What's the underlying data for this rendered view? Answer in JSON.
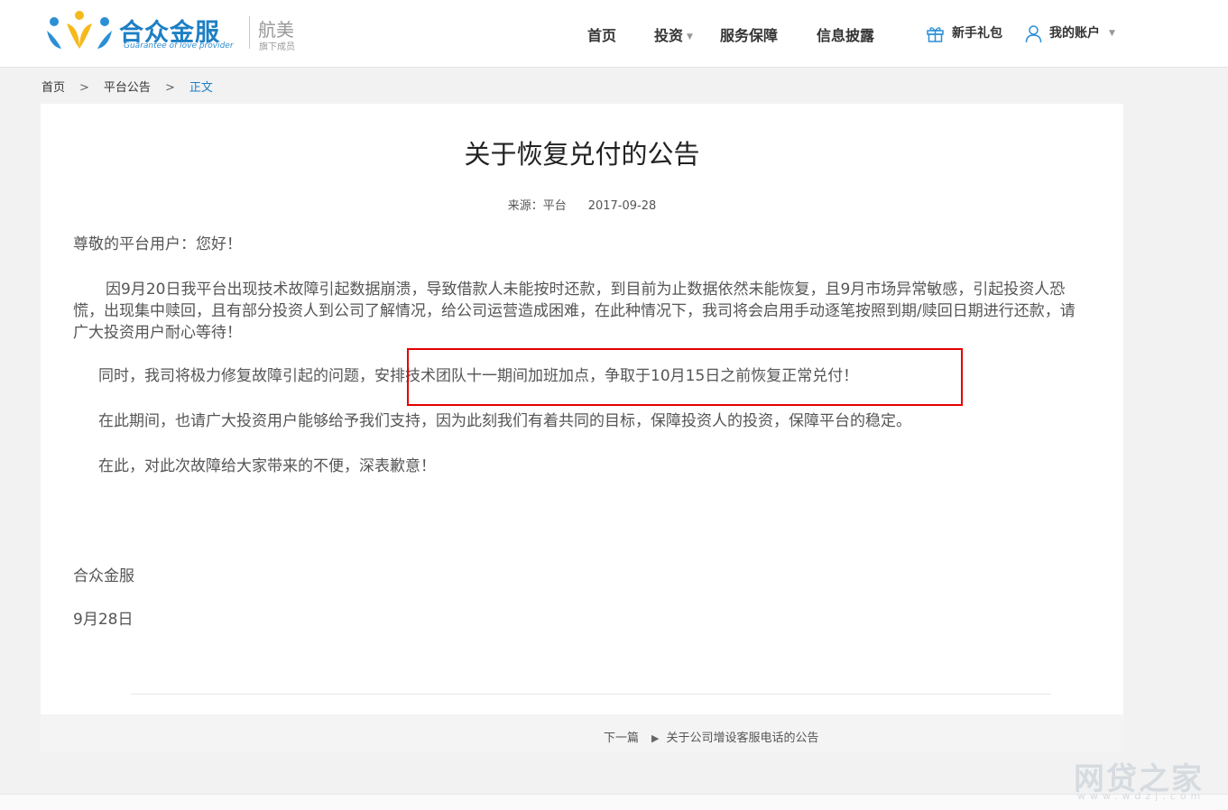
{
  "header": {
    "logo": {
      "name": "合众金服",
      "tagline": "Guarantee of love provider",
      "partner_brand": "航美",
      "partner_sub": "旗下成员"
    },
    "nav": [
      {
        "label": "首页",
        "has_dropdown": false
      },
      {
        "label": "投资",
        "has_dropdown": true
      },
      {
        "label": "服务保障",
        "has_dropdown": false
      },
      {
        "label": "信息披露",
        "has_dropdown": false
      }
    ],
    "gift": {
      "label": "新手礼包",
      "icon": "gift-icon"
    },
    "account": {
      "label": "我的账户",
      "icon": "user-icon",
      "has_dropdown": true
    }
  },
  "breadcrumb": {
    "items": [
      "首页",
      "平台公告",
      "正文"
    ],
    "separator": ">"
  },
  "article": {
    "title": "关于恢复兑付的公告",
    "source": "来源：平台",
    "date": "2017-09-28",
    "greeting": "尊敬的平台用户：您好！",
    "paragraph1": "因9月20日我平台出现技术故障引起数据崩溃，导致借款人未能按时还款，到目前为止数据依然未能恢复，且9月市场异常敏感，引起投资人恐慌，出现集中赎回，且有部分投资人到公司了解情况，给公司运营造成困难，在此种情况下，我司将会启用手动逐笔按照到期/赎回日期进行还款，请广大投资用户耐心等待！",
    "paragraph2": "同时，我司将极力修复故障引起的问题，安排技术团队十一期间加班加点，争取于10月15日之前恢复正常兑付！",
    "paragraph3": "在此期间，也请广大投资用户能够给予我们支持，因为此刻我们有着共同的目标，保障投资人的投资，保障平台的稳定。",
    "paragraph4": "在此，对此次故障给大家带来的不便，深表歉意！",
    "signature": "合众金服",
    "signature_date": "9月28日"
  },
  "annotation": {
    "color": "#e30000"
  },
  "footer_nav": {
    "next_label": "下一篇",
    "next_title": "关于公司增设客服电话的公告"
  },
  "watermark": {
    "text": "网贷之家",
    "url": "www.wdzj.com"
  },
  "colors": {
    "brand": "#1d7fc4",
    "logo_yellow": "#f6b81b",
    "logo_blue": "#2b8fd6"
  }
}
